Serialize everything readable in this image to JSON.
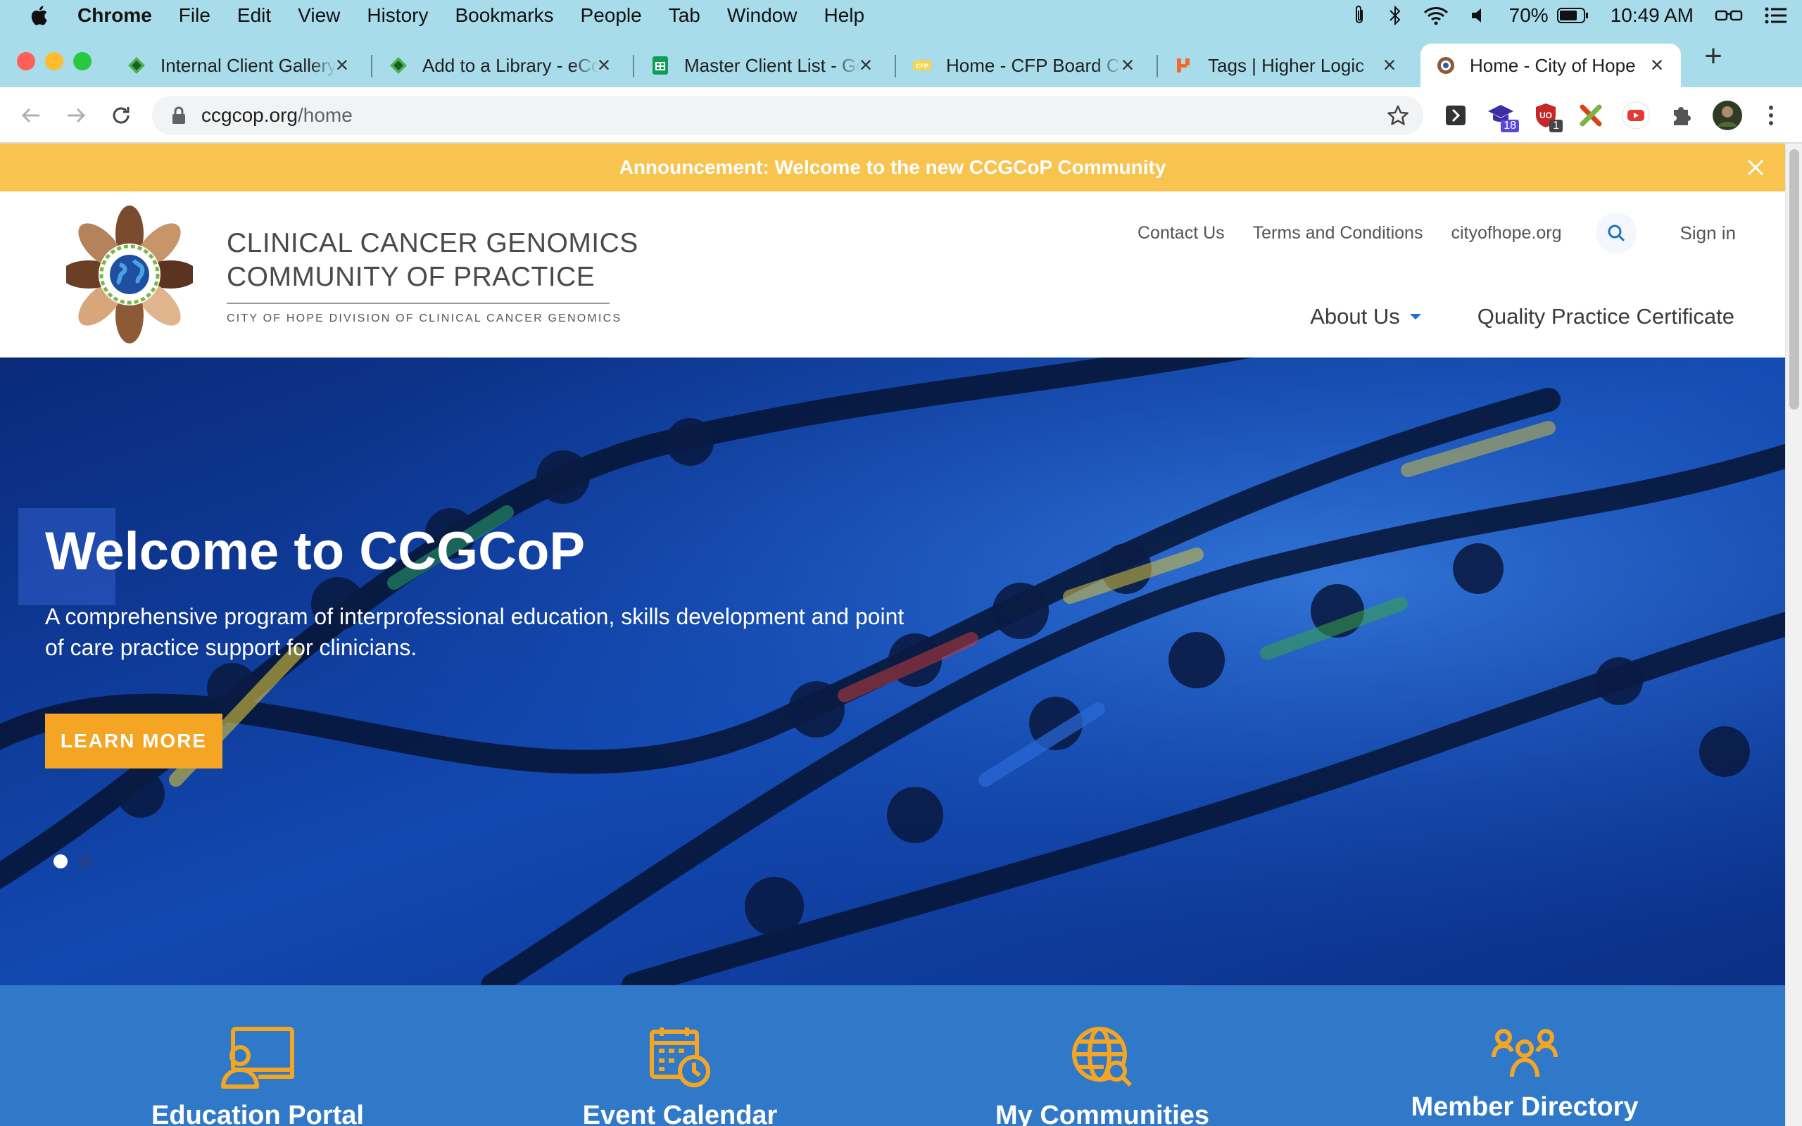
{
  "menubar": {
    "app": "Chrome",
    "items": [
      "File",
      "Edit",
      "View",
      "History",
      "Bookmarks",
      "People",
      "Tab",
      "Window",
      "Help"
    ],
    "battery": "70%",
    "time": "10:49 AM"
  },
  "tabs": [
    {
      "title": "Internal Client Gallery",
      "icon": "diamond-favicon"
    },
    {
      "title": "Add to a Library - eCo",
      "icon": "diamond-favicon"
    },
    {
      "title": "Master Client List - Go",
      "icon": "sheets-favicon"
    },
    {
      "title": "Home - CFP Board Car",
      "icon": "cfp-favicon"
    },
    {
      "title": "Tags | Higher Logic",
      "icon": "higher-logic-favicon"
    },
    {
      "title": "Home - City of Hope",
      "icon": "city-of-hope-favicon",
      "active": true
    }
  ],
  "address": {
    "domain": "ccgcop.org",
    "path": "/home"
  },
  "extensions": {
    "badge1": "18",
    "badge2": "1"
  },
  "announcement": "Announcement: Welcome to the new CCGCoP Community",
  "brand": {
    "line1": "CLINICAL CANCER GENOMICS",
    "line2": "COMMUNITY OF PRACTICE",
    "subline": "CITY OF HOPE DIVISION OF CLINICAL CANCER GENOMICS"
  },
  "toplinks": {
    "contact": "Contact Us",
    "terms": "Terms and Conditions",
    "site": "cityofhope.org",
    "signin": "Sign in"
  },
  "nav": {
    "about": "About Us",
    "certificate": "Quality Practice Certificate"
  },
  "hero": {
    "title": "Welcome to CCGCoP",
    "subtitle": "A comprehensive program of interprofessional education, skills development and point of care practice support for clinicians.",
    "button": "LEARN MORE"
  },
  "features": [
    {
      "label": "Education Portal",
      "icon": "laptop-user-icon"
    },
    {
      "label": "Event Calendar",
      "icon": "calendar-clock-icon"
    },
    {
      "label": "My Communities",
      "icon": "globe-search-icon"
    },
    {
      "label": "Member Directory",
      "icon": "people-group-icon"
    }
  ],
  "colors": {
    "accent": "#f4a524",
    "announcement": "#f8c34e",
    "feature_band": "#3079c8",
    "link_blue": "#1a73c8"
  }
}
